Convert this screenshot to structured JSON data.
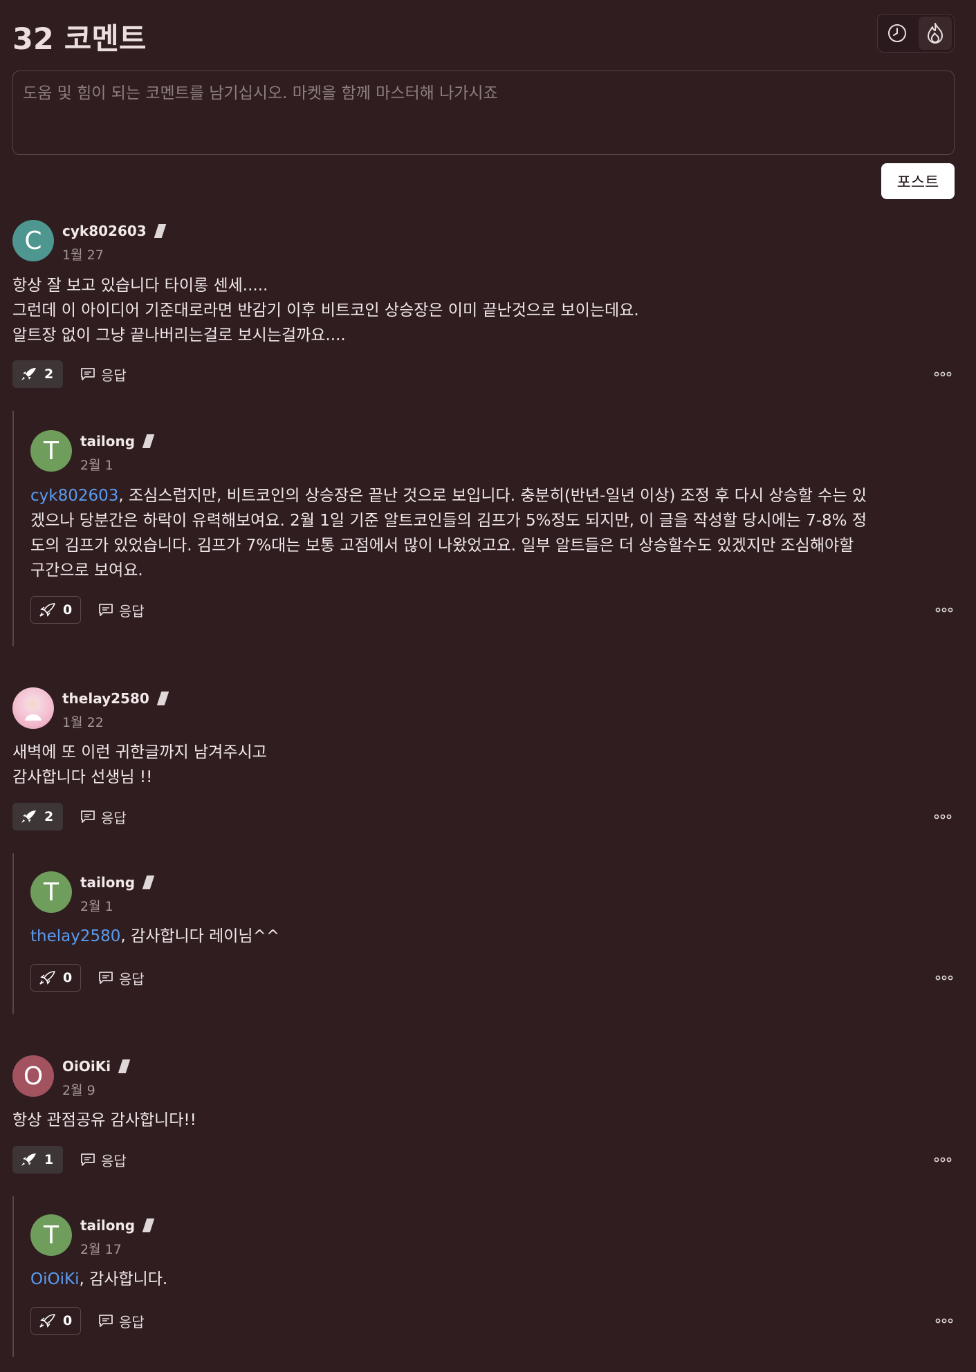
{
  "header": {
    "title": "32 코멘트",
    "sort_recent_icon": "clock-icon",
    "sort_hot_icon": "flame-icon"
  },
  "composer": {
    "placeholder": "도움 및 힘이 되는 코멘트를 남기십시오. 마켓을 함께 마스터해 나가시죠",
    "post_label": "포스트"
  },
  "actions": {
    "reply_label": "응답"
  },
  "colors": {
    "background": "#2f1d20",
    "mention": "#5b9bef"
  },
  "comments": [
    {
      "user": "cyk802603",
      "avatar_letter": "C",
      "avatar_color": "#4e9690",
      "date": "1월 27",
      "lines": [
        "항상 잘 보고 있습니다 타이롱 센세.....",
        "그런데 이 아이디어 기준대로라면 반감기 이후 비트코인 상승장은 이미 끝난것으로 보이는데요.",
        "알트장 없이 그냥 끝나버리는걸로 보시는걸까요...."
      ],
      "boosts": "2",
      "reply": {
        "user": "tailong",
        "avatar_letter": "T",
        "avatar_color": "#6f9d5c",
        "date": "2월 1",
        "mention": "cyk802603",
        "first": ", 조심스럽지만, 비트코인의 상승장은 끝난 것으로 보입니다. 충분히(반년-일년 이상) 조정 후 다시 상승할 수는 있",
        "lines": [
          "겠으나 당분간은 하락이 유력해보여요. 2월 1일 기준 알트코인들의 김프가 5%정도 되지만, 이 글을 작성할 당시에는 7-8% 정",
          "도의 김프가 있었습니다. 김프가 7%대는 보통 고점에서 많이 나왔었고요. 일부 알트들은 더 상승할수도 있겠지만 조심해야할",
          "구간으로 보여요."
        ],
        "boosts": "0"
      }
    },
    {
      "user": "thelay2580",
      "date": "1월 22",
      "lines": [
        "새벽에 또 이런 귀한글까지 남겨주시고",
        "감사합니다 선생님 !!"
      ],
      "boosts": "2",
      "reply": {
        "user": "tailong",
        "avatar_letter": "T",
        "date": "2월 1",
        "mention": "thelay2580",
        "first": ", 감사합니다 레이님^^",
        "boosts": "0"
      }
    },
    {
      "user": "OiOiKi",
      "avatar_letter": "O",
      "avatar_color": "#a2535f",
      "date": "2월 9",
      "lines": [
        "항상 관점공유 감사합니다!!"
      ],
      "boosts": "1",
      "reply": {
        "user": "tailong",
        "avatar_letter": "T",
        "date": "2월 17",
        "mention": "OiOiKi",
        "first": ", 감사합니다.",
        "boosts": "0"
      }
    }
  ]
}
